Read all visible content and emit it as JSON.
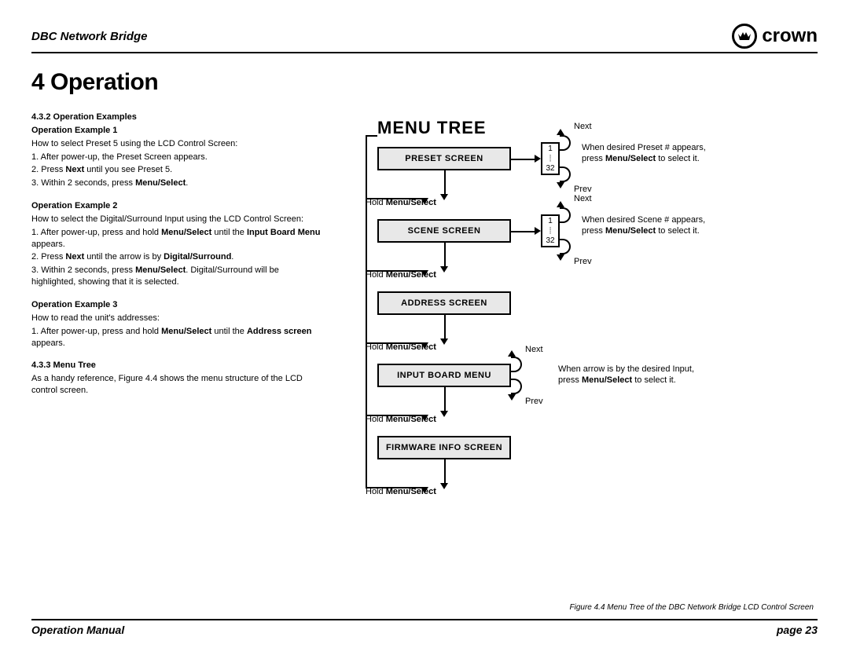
{
  "header": {
    "product": "DBC Network Bridge",
    "brand": "crown"
  },
  "section_title": "4 Operation",
  "left": {
    "s432": "4.3.2 Operation Examples",
    "ex1_head": "Operation Example 1",
    "ex1_intro": "How to select Preset 5 using the LCD Control Screen:",
    "ex1_1": "1. After power-up, the Preset Screen appears.",
    "ex1_2a": "2. Press ",
    "ex1_2b": "Next",
    "ex1_2c": " until you see Preset 5.",
    "ex1_3a": "3. Within 2 seconds, press ",
    "ex1_3b": "Menu/Select",
    "ex1_3c": ".",
    "ex2_head": "Operation Example 2",
    "ex2_intro": "How to select the Digital/Surround Input using the LCD Control Screen:",
    "ex2_1a": "1. After power-up, press and hold ",
    "ex2_1b": "Menu/Select",
    "ex2_1c": " until the ",
    "ex2_1d": "Input Board Menu",
    "ex2_1e": " appears.",
    "ex2_2a": "2. Press ",
    "ex2_2b": "Next",
    "ex2_2c": " until the arrow is by ",
    "ex2_2d": "Digital/Surround",
    "ex2_2e": ".",
    "ex2_3a": "3. Within 2 seconds, press ",
    "ex2_3b": "Menu/Select",
    "ex2_3c": ". Digital/Surround will be highlighted, showing that it is selected.",
    "ex3_head": "Operation Example 3",
    "ex3_intro": "How to read the unit's addresses:",
    "ex3_1a": "1. After power-up, press and hold ",
    "ex3_1b": "Menu/Select",
    "ex3_1c": " until the ",
    "ex3_1d": "Address screen",
    "ex3_1e": " appears.",
    "s433": "4.3.3 Menu Tree",
    "s433_body": "As a handy reference, Figure 4.4 shows the menu structure of the LCD control screen."
  },
  "diagram": {
    "title": "MENU TREE",
    "screens": {
      "preset": "PRESET SCREEN",
      "scene": "SCENE SCREEN",
      "address": "ADDRESS SCREEN",
      "input": "INPUT BOARD MENU",
      "firmware": "FIRMWARE INFO SCREEN"
    },
    "hold_pre": "Hold ",
    "hold_b": "Menu/Select",
    "nav_next": "Next",
    "nav_prev": "Prev",
    "range_top": "1",
    "range_bot": "32",
    "note_preset_a": "When desired Preset # appears,",
    "note_preset_b": "press ",
    "note_preset_c": "Menu/Select",
    "note_preset_d": " to select it.",
    "note_scene_a": "When desired Scene # appears,",
    "note_scene_b": "press ",
    "note_input_a": "When arrow is by the desired Input,",
    "note_input_b": "press "
  },
  "caption": "Figure 4.4 Menu Tree of the DBC Network Bridge LCD Control Screen",
  "footer": {
    "left": "Operation Manual",
    "right": "page 23"
  }
}
